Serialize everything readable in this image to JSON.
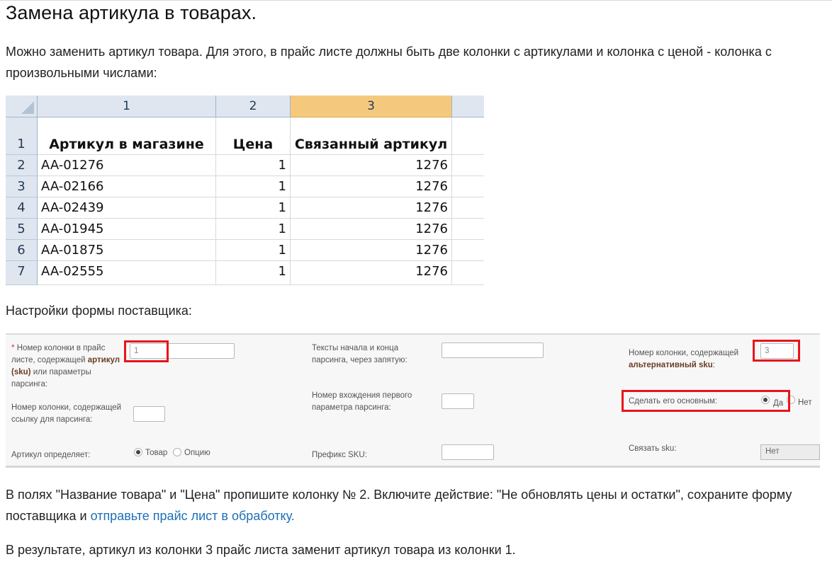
{
  "page": {
    "title": "Замена артикула в товарах.",
    "intro": "Можно заменить артикул товара. Для этого, в прайс листе должны быть две колонки с артикулами и колонка с ценой - колонка с произвольными числами:",
    "form_heading": "Настройки формы поставщика:",
    "instruction_text": "В полях \"Название товара\" и \"Цена\" пропишите колонку № 2. Включите действие: \"Не обновлять цены и остатки\", сохраните форму поставщика и ",
    "instruction_link": "отправьте прайс лист в обработку.",
    "result": "В результате, артикул из колонки 3 прайс листа заменит артикул товара из колонки 1."
  },
  "sheet": {
    "col_headers": [
      "1",
      "2",
      "3"
    ],
    "row_numbers": [
      "1",
      "2",
      "3",
      "4",
      "5",
      "6",
      "7"
    ],
    "header_row": [
      "Артикул в магазине",
      "Цена",
      "Связанный артикул"
    ],
    "rows": [
      [
        "AA-01276",
        "1",
        "1276"
      ],
      [
        "AA-02166",
        "1",
        "1276"
      ],
      [
        "AA-02439",
        "1",
        "1276"
      ],
      [
        "AA-01945",
        "1",
        "1276"
      ],
      [
        "AA-01875",
        "1",
        "1276"
      ],
      [
        "AA-02555",
        "1",
        "1276"
      ]
    ],
    "selected_column": "3",
    "colors": {
      "header_bg": "#dfe6ef",
      "selected_bg": "#f5c97d"
    }
  },
  "form": {
    "required_mark": "*",
    "sku_col_label_pre": "Номер колонки в прайс листе, содержащей",
    "sku_col_label_bold": "артикул (sku)",
    "sku_col_label_post": "или параметры парсинга:",
    "sku_col_value": "1",
    "link_col_label": "Номер колонки, содержащей ссылку для парсинга:",
    "link_col_value": "",
    "article_defines_label": "Артикул определяет:",
    "article_options": [
      "Товар",
      "Опцию"
    ],
    "article_selected": "Товар",
    "parse_texts_label": "Тексты начала и конца парсинга, через запятую:",
    "parse_texts_value": "",
    "first_occurrence_label": "Номер вхождения первого параметра парсинга:",
    "first_occurrence_value": "",
    "sku_prefix_label": "Префикс SKU:",
    "sku_prefix_value": "",
    "alt_sku_label_pre": "Номер колонки, содержащей",
    "alt_sku_label_bold": "альтернативный sku",
    "alt_sku_label_post": ":",
    "alt_sku_value": "3",
    "make_main_label": "Сделать его основным:",
    "make_main_options": [
      "Да",
      "Нет"
    ],
    "make_main_selected": "Да",
    "link_sku_label": "Связать sku:",
    "link_sku_value": "Нет",
    "highlight_color": "#e8141b"
  }
}
